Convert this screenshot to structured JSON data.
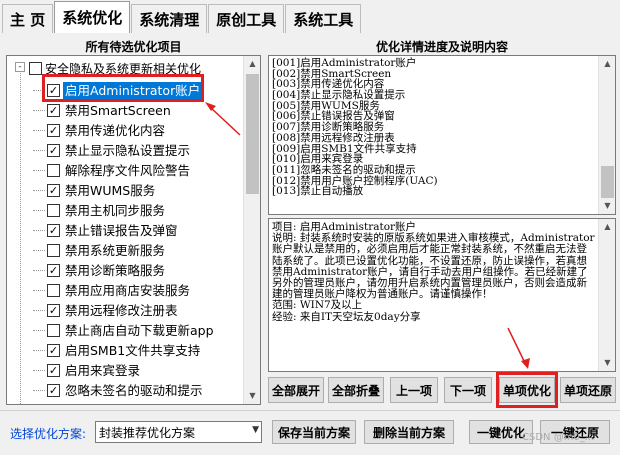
{
  "tabs": [
    "主 页",
    "系统优化",
    "系统清理",
    "原创工具",
    "系统工具"
  ],
  "active_tab": 1,
  "left_header": "所有待选优化项目",
  "right_header": "优化详情进度及说明内容",
  "tree": {
    "group_label": "安全隐私及系统更新相关优化",
    "group_expander": "-",
    "items": [
      {
        "label": "启用Administrator账户",
        "checked": true,
        "selected": true
      },
      {
        "label": "禁用SmartScreen",
        "checked": true
      },
      {
        "label": "禁用传递优化内容",
        "checked": true
      },
      {
        "label": "禁止显示隐私设置提示",
        "checked": true
      },
      {
        "label": "解除程序文件风险警告",
        "checked": false
      },
      {
        "label": "禁用WUMS服务",
        "checked": true
      },
      {
        "label": "禁用主机同步服务",
        "checked": false
      },
      {
        "label": "禁止错误报告及弹窗",
        "checked": true
      },
      {
        "label": "禁用系统更新服务",
        "checked": false
      },
      {
        "label": "禁用诊断策略服务",
        "checked": true
      },
      {
        "label": "禁用应用商店安装服务",
        "checked": false
      },
      {
        "label": "禁用远程修改注册表",
        "checked": true
      },
      {
        "label": "禁止商店自动下载更新app",
        "checked": false
      },
      {
        "label": "启用SMB1文件共享支持",
        "checked": true
      },
      {
        "label": "启用来宾登录",
        "checked": true
      },
      {
        "label": "忽略未签名的驱动和提示",
        "checked": true
      }
    ]
  },
  "progress_list": [
    "[001]启用Administrator账户",
    "[002]禁用SmartScreen",
    "[003]禁用传递优化内容",
    "[004]禁止显示隐私设置提示",
    "[005]禁用WUMS服务",
    "[006]禁止错误报告及弹窗",
    "[007]禁用诊断策略服务",
    "[008]禁用远程修改注册表",
    "[009]启用SMB1文件共享支持",
    "[010]启用来宾登录",
    "[011]忽略未签名的驱动和提示",
    "[012]禁用用户账户控制程序(UAC)",
    "[013]禁止自动播放"
  ],
  "description": {
    "lines": [
      "项目: 启用Administrator账户",
      "说明: 封装系统时安装的原版系统如果进入审核模式，Administrator账户默认是禁用的，必须启用后才能正常封装系统，不然重启无法登陆系统了。此项已设置优化功能，不设置还原，防止误操作，若真想禁用Administrator账户，请自行手动去用户组操作。若已经新建了另外的管理员账户，请勿用升启系统内置管理员账户，否则会造成新建的管理员账户降权为普通账户。请谨慎操作！",
      "范围: WIN7及以上",
      "经验: 来自IT天空坛友0day分享"
    ]
  },
  "action_buttons": [
    "全部展开",
    "全部折叠",
    "上一项",
    "下一项",
    "单项优化",
    "单项还原"
  ],
  "bottom": {
    "scheme_label": "选择优化方案:",
    "scheme_value": "封装推荐优化方案",
    "buttons": [
      "保存当前方案",
      "删除当前方案",
      "一键优化",
      "一键还原"
    ]
  },
  "watermark": "CSDN @m0_...",
  "colors": {
    "selection": "#0078d7",
    "highlight_box": "#e02020",
    "link_label": "#0046d5"
  }
}
